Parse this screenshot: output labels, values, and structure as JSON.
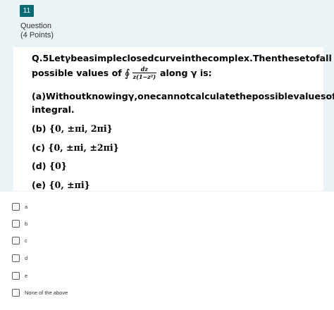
{
  "question": {
    "number": "11",
    "label": "Question",
    "points": "(4 Points)",
    "stem_line1_words": [
      "Q.5",
      "Let",
      "γ",
      "be",
      "a",
      "simple",
      "closed",
      "curve",
      "in",
      "the",
      "complex.",
      "Then",
      "the",
      "set",
      "of",
      "all"
    ],
    "stem_line2_prefix": "possible values of",
    "integral_symbol": "∮",
    "integral_numerator": "dz",
    "integral_denominator": "z(1−z²)",
    "stem_line2_suffix": "along γ is:",
    "option_a_line1_words": [
      "(a)",
      "Without",
      "knowing",
      "γ,",
      "one",
      "cannot",
      "calculate",
      "the",
      "possible",
      "values",
      "of"
    ],
    "option_a_line2": "integral.",
    "option_b_label": "(b)",
    "option_b_set": "{0, ±πi, 2πi}",
    "option_c_label": "(c)",
    "option_c_set": "{0, ±πi, ±2πi}",
    "option_d_label": "(d)",
    "option_d_set": "{0}",
    "option_e_label": "(e)",
    "option_e_set": "{0, ±πi}"
  },
  "choices": [
    {
      "label": "a"
    },
    {
      "label": "b"
    },
    {
      "label": "c"
    },
    {
      "label": "d"
    },
    {
      "label": "e"
    },
    {
      "label": "None of the above"
    }
  ],
  "colors": {
    "badge": "#0b6a72",
    "card_background": "#eaf3f6"
  }
}
